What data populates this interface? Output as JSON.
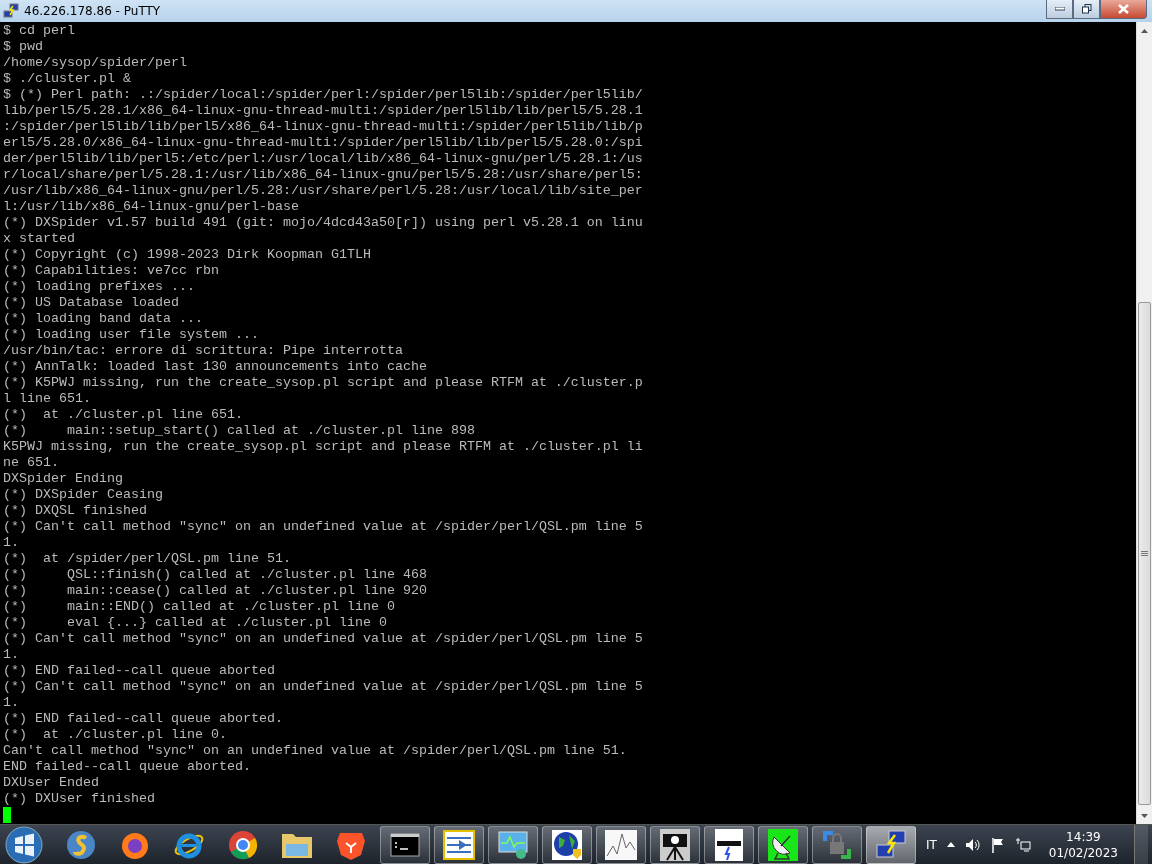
{
  "window": {
    "title": "46.226.178.86 - PuTTY"
  },
  "terminal": {
    "lines": [
      "$ cd perl",
      "$ pwd",
      "/home/sysop/spider/perl",
      "$ ./cluster.pl &",
      "$ (*) Perl path: .:/spider/local:/spider/perl:/spider/perl5lib:/spider/perl5lib/",
      "lib/perl5/5.28.1/x86_64-linux-gnu-thread-multi:/spider/perl5lib/lib/perl5/5.28.1",
      ":/spider/perl5lib/lib/perl5/x86_64-linux-gnu-thread-multi:/spider/perl5lib/lib/p",
      "erl5/5.28.0/x86_64-linux-gnu-thread-multi:/spider/perl5lib/lib/perl5/5.28.0:/spi",
      "der/perl5lib/lib/perl5:/etc/perl:/usr/local/lib/x86_64-linux-gnu/perl/5.28.1:/us",
      "r/local/share/perl/5.28.1:/usr/lib/x86_64-linux-gnu/perl5/5.28:/usr/share/perl5:",
      "/usr/lib/x86_64-linux-gnu/perl/5.28:/usr/share/perl/5.28:/usr/local/lib/site_per",
      "l:/usr/lib/x86_64-linux-gnu/perl-base",
      "(*) DXSpider v1.57 build 491 (git: mojo/4dcd43a50[r]) using perl v5.28.1 on linu",
      "x started",
      "(*) Copyright (c) 1998-2023 Dirk Koopman G1TLH",
      "(*) Capabilities: ve7cc rbn",
      "(*) loading prefixes ...",
      "(*) US Database loaded",
      "(*) loading band data ...",
      "(*) loading user file system ...",
      "/usr/bin/tac: errore di scrittura: Pipe interrotta",
      "(*) AnnTalk: loaded last 130 announcements into cache",
      "(*) K5PWJ missing, run the create_sysop.pl script and please RTFM at ./cluster.p",
      "l line 651.",
      "(*)  at ./cluster.pl line 651.",
      "(*)     main::setup_start() called at ./cluster.pl line 898",
      "K5PWJ missing, run the create_sysop.pl script and please RTFM at ./cluster.pl li",
      "ne 651.",
      "DXSpider Ending",
      "(*) DXSpider Ceasing",
      "(*) DXQSL finished",
      "(*) Can't call method \"sync\" on an undefined value at /spider/perl/QSL.pm line 5",
      "1.",
      "(*)  at /spider/perl/QSL.pm line 51.",
      "(*)     QSL::finish() called at ./cluster.pl line 468",
      "(*)     main::cease() called at ./cluster.pl line 920",
      "(*)     main::END() called at ./cluster.pl line 0",
      "(*)     eval {...} called at ./cluster.pl line 0",
      "(*) Can't call method \"sync\" on an undefined value at /spider/perl/QSL.pm line 5",
      "1.",
      "(*) END failed--call queue aborted",
      "(*) Can't call method \"sync\" on an undefined value at /spider/perl/QSL.pm line 5",
      "1.",
      "(*) END failed--call queue aborted.",
      "(*)  at ./cluster.pl line 0.",
      "Can't call method \"sync\" on an undefined value at /spider/perl/QSL.pm line 51.",
      "END failed--call queue aborted.",
      "DXUser Ended",
      "(*) DXUser finished"
    ]
  },
  "taskbar": {
    "buttons": [
      {
        "running": false,
        "selected": false
      },
      {
        "running": false,
        "selected": false
      },
      {
        "running": false,
        "selected": false
      },
      {
        "running": false,
        "selected": false
      },
      {
        "running": false,
        "selected": false
      },
      {
        "running": false,
        "selected": false
      },
      {
        "running": true,
        "selected": false
      },
      {
        "running": true,
        "selected": false
      },
      {
        "running": true,
        "selected": false
      },
      {
        "running": true,
        "selected": false
      },
      {
        "running": true,
        "selected": false
      },
      {
        "running": true,
        "selected": false
      },
      {
        "running": true,
        "selected": false
      },
      {
        "running": true,
        "selected": false
      },
      {
        "running": true,
        "selected": false
      },
      {
        "running": true,
        "selected": true
      }
    ],
    "language": "IT",
    "time": "14:39",
    "date": "01/02/2023"
  }
}
